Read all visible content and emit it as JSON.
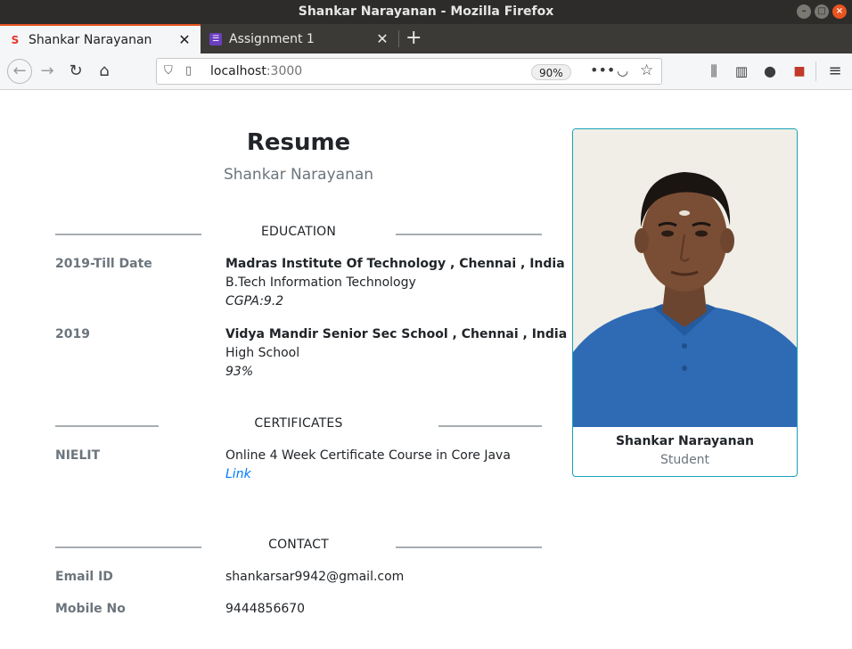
{
  "window": {
    "title": "Shankar Narayanan - Mozilla Firefox"
  },
  "tabs": [
    {
      "label": "Shankar Narayanan",
      "active": true
    },
    {
      "label": "Assignment 1",
      "active": false
    }
  ],
  "urlbar": {
    "host": "localhost",
    "port": ":3000",
    "zoom": "90%"
  },
  "resume": {
    "title": "Resume",
    "name": "Shankar Narayanan",
    "education": {
      "heading": "EDUCATION",
      "entries": [
        {
          "period": "2019-Till Date",
          "institution": "Madras Institute Of Technology , Chennai , India",
          "course": "B.Tech Information Technology",
          "score": "CGPA:9.2"
        },
        {
          "period": "2019",
          "institution": "Vidya Mandir Senior Sec School , Chennai , India",
          "course": "High School",
          "score": "93%"
        }
      ]
    },
    "certificates": {
      "heading": "CERTIFICATES",
      "entries": [
        {
          "issuer": "NIELIT",
          "title": "Online 4 Week Certificate Course in Core Java",
          "link": "Link"
        }
      ]
    },
    "contact": {
      "heading": "CONTACT",
      "email_label": "Email ID",
      "email": "shankarsar9942@gmail.com",
      "mobile_label": "Mobile No",
      "mobile": "9444856670"
    }
  },
  "profile_card": {
    "name": "Shankar Narayanan",
    "role": "Student"
  },
  "colors": {
    "accent_orange": "#e95420",
    "card_border": "#17a2b8",
    "link": "#007bff",
    "muted": "#6c757d"
  }
}
